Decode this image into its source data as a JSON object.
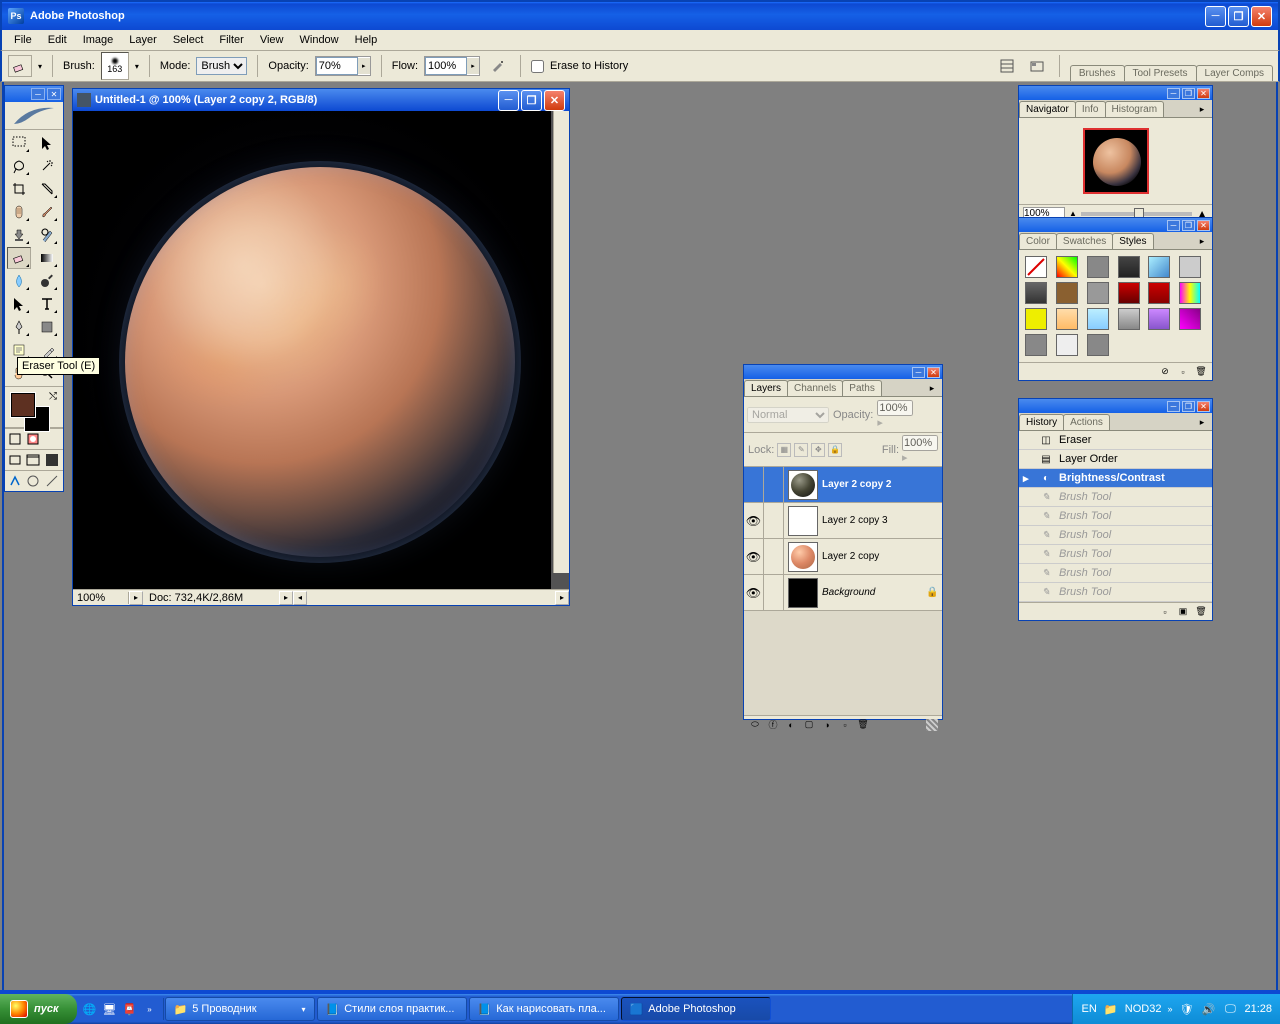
{
  "app": {
    "title": "Adobe Photoshop"
  },
  "menubar": [
    "File",
    "Edit",
    "Image",
    "Layer",
    "Select",
    "Filter",
    "View",
    "Window",
    "Help"
  ],
  "options": {
    "brush_label": "Brush:",
    "brush_size": "163",
    "mode_label": "Mode:",
    "mode_value": "Brush",
    "opacity_label": "Opacity:",
    "opacity_value": "70%",
    "flow_label": "Flow:",
    "flow_value": "100%",
    "erase_history": "Erase to History",
    "docked_tabs": [
      "Brushes",
      "Tool Presets",
      "Layer Comps"
    ]
  },
  "tooltip": "Eraser Tool (E)",
  "document": {
    "title": "Untitled-1 @ 100% (Layer 2 copy 2, RGB/8)",
    "zoom": "100%",
    "status": "Doc: 732,4K/2,86M"
  },
  "colors": {
    "fg": "#5d3021",
    "bg": "#000000"
  },
  "navigator": {
    "tab1": "Navigator",
    "tab2": "Info",
    "tab3": "Histogram",
    "zoom": "100%"
  },
  "stylesPanel": {
    "tabs": [
      "Color",
      "Swatches",
      "Styles"
    ]
  },
  "layersPanel": {
    "tabs": [
      "Layers",
      "Channels",
      "Paths"
    ],
    "blend": "Normal",
    "opacity_label": "Opacity:",
    "opacity": "100%",
    "lock_label": "Lock:",
    "fill_label": "Fill:",
    "fill": "100%",
    "layers": [
      {
        "name": "Layer 2 copy 2",
        "visible": false,
        "selected": true,
        "thumb": "planet-dark",
        "bold": true
      },
      {
        "name": "Layer 2 copy 3",
        "visible": true,
        "thumb": "checker"
      },
      {
        "name": "Layer 2 copy",
        "visible": true,
        "thumb": "planet-light"
      },
      {
        "name": "Background",
        "visible": true,
        "thumb": "black",
        "locked": true,
        "italic": true
      }
    ]
  },
  "historyPanel": {
    "tabs": [
      "History",
      "Actions"
    ],
    "items": [
      {
        "label": "Eraser",
        "icon": "eraser"
      },
      {
        "label": "Layer Order",
        "icon": "layers"
      },
      {
        "label": "Brightness/Contrast",
        "icon": "adjust",
        "selected": true,
        "current": true
      },
      {
        "label": "Brush Tool",
        "icon": "brush",
        "dim": true
      },
      {
        "label": "Brush Tool",
        "icon": "brush",
        "dim": true
      },
      {
        "label": "Brush Tool",
        "icon": "brush",
        "dim": true
      },
      {
        "label": "Brush Tool",
        "icon": "brush",
        "dim": true
      },
      {
        "label": "Brush Tool",
        "icon": "brush",
        "dim": true
      },
      {
        "label": "Brush Tool",
        "icon": "brush",
        "dim": true
      }
    ]
  },
  "taskbar": {
    "start": "пуск",
    "buttons": [
      {
        "label": "5 Проводник",
        "folder": true
      },
      {
        "label": "Стили слоя практик...",
        "word": true
      },
      {
        "label": "Как нарисовать пла...",
        "word": true
      },
      {
        "label": "Adobe Photoshop",
        "ps": true,
        "active": true
      }
    ],
    "lang": "EN",
    "tray_label": "NOD32",
    "clock": "21:28"
  }
}
